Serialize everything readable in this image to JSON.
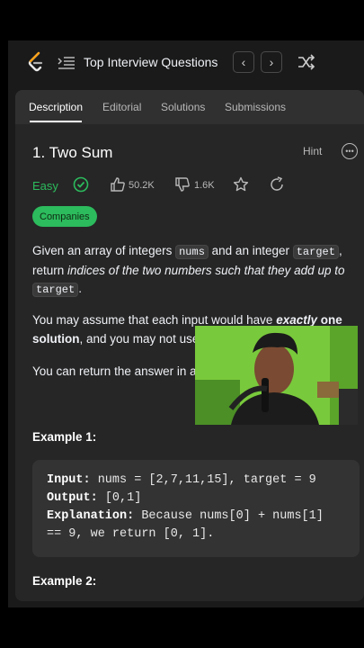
{
  "topbar": {
    "list_title": "Top Interview Questions",
    "prev_icon": "chevron-left-icon",
    "next_icon": "chevron-right-icon"
  },
  "tabs": [
    "Description",
    "Editorial",
    "Solutions",
    "Submissions"
  ],
  "problem": {
    "title": "1. Two Sum",
    "hint": "Hint",
    "difficulty": "Easy",
    "likes": "50.2K",
    "dislikes": "1.6K",
    "companies": "Companies"
  },
  "description": {
    "p1_a": "Given an array of integers ",
    "p1_code1": "nums",
    "p1_b": " and an integer ",
    "p1_code2": "target",
    "p1_c": ", return ",
    "p1_em": "indices of the two numbers such that they add up to",
    "p1_code3": "target",
    "p1_d": ".",
    "p2_a": "You may assume that each input would have ",
    "p2_strong_em": "exactly",
    "p2_b": " ",
    "p2_strong": "one solution",
    "p2_c": ", and you may not use",
    "p3": "You can return the answer in a"
  },
  "example1": {
    "title": "Example 1:",
    "input_label": "Input:",
    "input_value": " nums = [2,7,11,15], target = 9",
    "output_label": "Output:",
    "output_value": " [0,1]",
    "explanation_label": "Explanation:",
    "explanation_value": " Because nums[0] + nums[1]",
    "explanation_value2": "== 9, we return [0, 1]."
  },
  "example2": {
    "title": "Example 2:"
  },
  "colors": {
    "easy": "#2cbb5d",
    "panel": "#262626",
    "background": "#1a1a1a"
  }
}
